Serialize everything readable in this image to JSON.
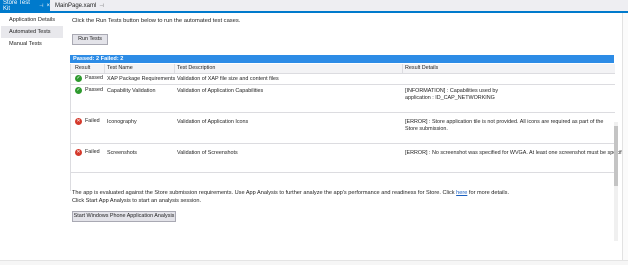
{
  "tabs": {
    "active": "Store Test Kit",
    "inactive": "MainPage.xaml"
  },
  "sidebar": {
    "items": [
      {
        "label": "Application Details"
      },
      {
        "label": "Automated Tests"
      },
      {
        "label": "Manual Tests"
      }
    ]
  },
  "main": {
    "instruction": "Click the Run Tests button below to run the automated test cases.",
    "run_button": "Run Tests",
    "summary": "Passed: 2  Failed: 2",
    "columns": [
      "Result",
      "Test Name",
      "Test Description",
      "Result Details"
    ],
    "rows": [
      {
        "result": "Passed",
        "name": "XAP Package Requirements",
        "description": "Validation of XAP file size and content files",
        "details": ""
      },
      {
        "result": "Passed",
        "name": "Capability Validation",
        "description": "Validation of Application Capabilities",
        "details": "[INFORMATION] : Capabilities used by application : ID_CAP_NETWORKING"
      },
      {
        "result": "Failed",
        "name": "Iconography",
        "description": "Validation of Application Icons",
        "details": "[ERROR] : Store application tile is not provided. All icons are required as part of the Store submission."
      },
      {
        "result": "Failed",
        "name": "Screenshots",
        "description": "Validation of Screenshots",
        "details": "[ERROR] : No screenshot was specified for WVGA. At least one screenshot must be specified."
      }
    ],
    "footer_line1_before": "The app is evaluated against the Store submission requirements. Use App Analysis to further analyze the app's performance and readiness for Store. Click ",
    "footer_link": "here",
    "footer_line1_after": " for more details.",
    "footer_line2": "Click Start App Analysis to start an analysis session.",
    "analysis_button": "Start Windows Phone Application Analysis"
  },
  "colors": {
    "accent": "#007acc",
    "header_bar": "#2d8ce6",
    "pass": "#2e9a2e",
    "fail": "#d53a2c"
  }
}
